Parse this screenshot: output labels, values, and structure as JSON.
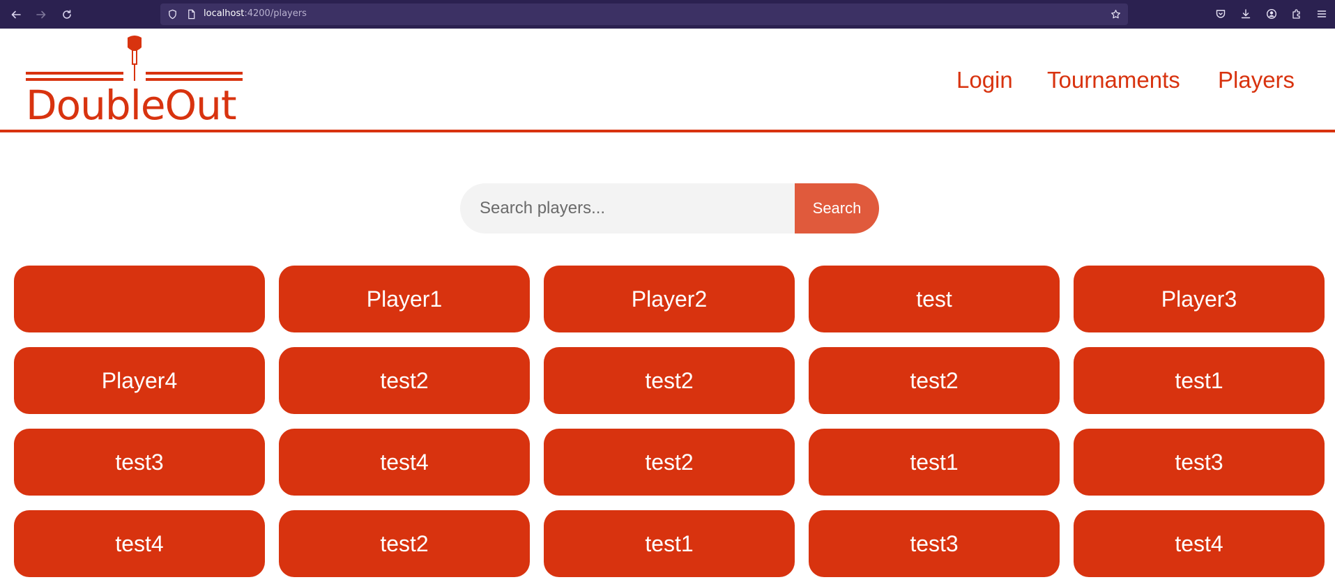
{
  "browser": {
    "url_host": "localhost",
    "url_path": ":4200/players"
  },
  "header": {
    "logo_text": "DoubleOut",
    "nav": [
      {
        "label": "Login"
      },
      {
        "label": "Tournaments"
      },
      {
        "label": "Players"
      }
    ]
  },
  "search": {
    "placeholder": "Search players...",
    "button_label": "Search"
  },
  "players": [
    {
      "name": ""
    },
    {
      "name": "Player1"
    },
    {
      "name": "Player2"
    },
    {
      "name": "test"
    },
    {
      "name": "Player3"
    },
    {
      "name": "Player4"
    },
    {
      "name": "test2"
    },
    {
      "name": "test2"
    },
    {
      "name": "test2"
    },
    {
      "name": "test1"
    },
    {
      "name": "test3"
    },
    {
      "name": "test4"
    },
    {
      "name": "test2"
    },
    {
      "name": "test1"
    },
    {
      "name": "test3"
    },
    {
      "name": "test4"
    },
    {
      "name": "test2"
    },
    {
      "name": "test1"
    },
    {
      "name": "test3"
    },
    {
      "name": "test4"
    }
  ],
  "colors": {
    "brand": "#d8330f",
    "search_button": "#e05a3c",
    "browser_bar": "#2b2150"
  }
}
